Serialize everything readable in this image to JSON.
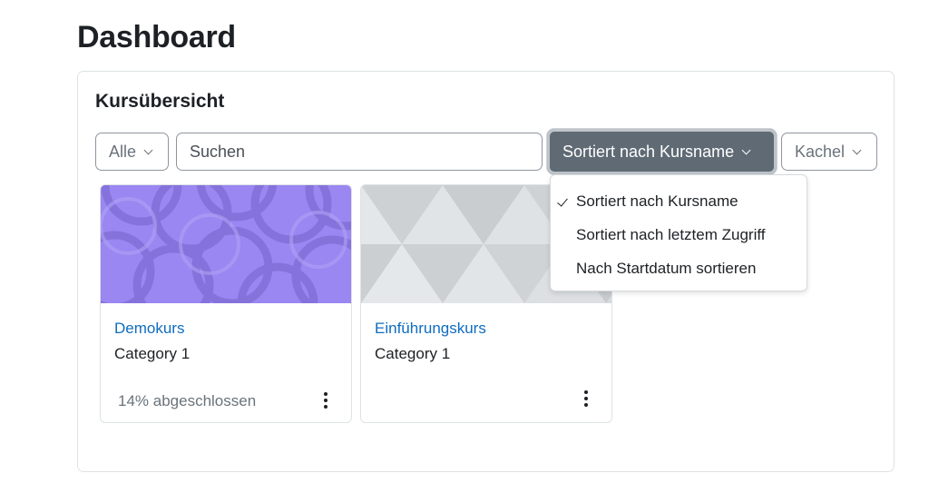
{
  "page": {
    "title": "Dashboard"
  },
  "block": {
    "title": "Kursübersicht",
    "filter_label": "Alle",
    "search_placeholder": "Suchen",
    "sort_label": "Sortiert nach Kursname",
    "view_label": "Kachel"
  },
  "courses": [
    {
      "name": "Demokurs",
      "category": "Category 1",
      "progress": "14% abgeschlossen",
      "progress_percent": 14,
      "image": "purple-circles-pattern"
    },
    {
      "name": "Einführungskurs",
      "category": "Category 1",
      "image": "grey-triangles-pattern"
    }
  ],
  "sort_menu": {
    "items": [
      {
        "label": "Sortiert nach Kursname",
        "selected": true
      },
      {
        "label": "Sortiert nach letztem Zugriff",
        "selected": false
      },
      {
        "label": "Nach Startdatum sortieren",
        "selected": false
      }
    ]
  },
  "colors": {
    "link": "#0f6cbf",
    "sort_button": "#5f6a74",
    "card_purple": "#9a87f2"
  }
}
